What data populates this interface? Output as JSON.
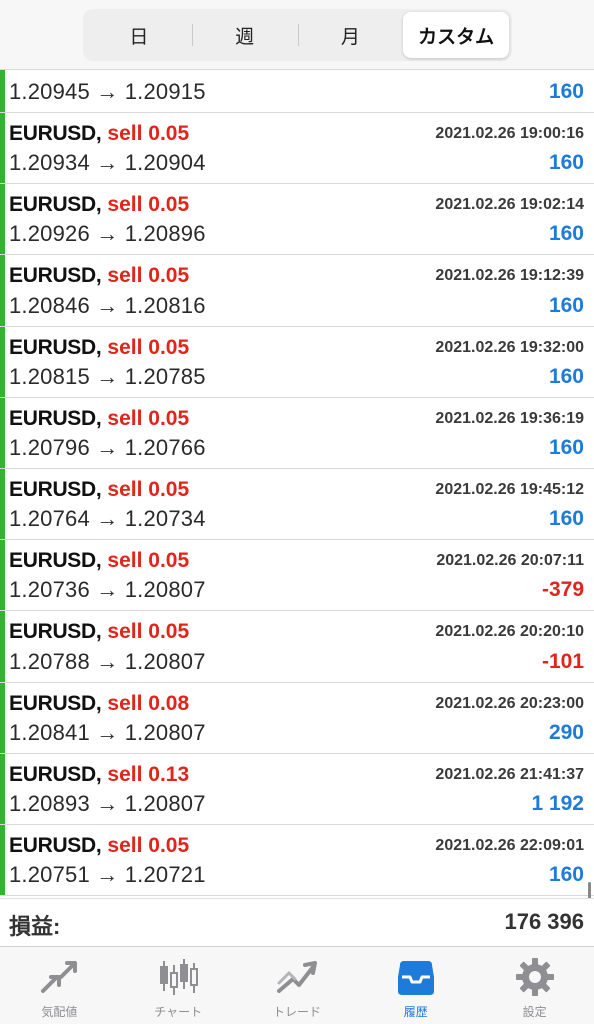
{
  "segments": [
    "日",
    "週",
    "月",
    "カスタム"
  ],
  "partial_row": {
    "prices": "1.20945 → 1.20915",
    "profit": "160"
  },
  "trades": [
    {
      "symbol": "EURUSD,",
      "side": "sell 0.05",
      "time": "2021.02.26 19:00:16",
      "prices": "1.20934 → 1.20904",
      "profit": "160",
      "sign": "pos"
    },
    {
      "symbol": "EURUSD,",
      "side": "sell 0.05",
      "time": "2021.02.26 19:02:14",
      "prices": "1.20926 → 1.20896",
      "profit": "160",
      "sign": "pos"
    },
    {
      "symbol": "EURUSD,",
      "side": "sell 0.05",
      "time": "2021.02.26 19:12:39",
      "prices": "1.20846 → 1.20816",
      "profit": "160",
      "sign": "pos"
    },
    {
      "symbol": "EURUSD,",
      "side": "sell 0.05",
      "time": "2021.02.26 19:32:00",
      "prices": "1.20815 → 1.20785",
      "profit": "160",
      "sign": "pos"
    },
    {
      "symbol": "EURUSD,",
      "side": "sell 0.05",
      "time": "2021.02.26 19:36:19",
      "prices": "1.20796 → 1.20766",
      "profit": "160",
      "sign": "pos"
    },
    {
      "symbol": "EURUSD,",
      "side": "sell 0.05",
      "time": "2021.02.26 19:45:12",
      "prices": "1.20764 → 1.20734",
      "profit": "160",
      "sign": "pos"
    },
    {
      "symbol": "EURUSD,",
      "side": "sell 0.05",
      "time": "2021.02.26 20:07:11",
      "prices": "1.20736 → 1.20807",
      "profit": "-379",
      "sign": "neg"
    },
    {
      "symbol": "EURUSD,",
      "side": "sell 0.05",
      "time": "2021.02.26 20:20:10",
      "prices": "1.20788 → 1.20807",
      "profit": "-101",
      "sign": "neg"
    },
    {
      "symbol": "EURUSD,",
      "side": "sell 0.08",
      "time": "2021.02.26 20:23:00",
      "prices": "1.20841 → 1.20807",
      "profit": "290",
      "sign": "pos"
    },
    {
      "symbol": "EURUSD,",
      "side": "sell 0.13",
      "time": "2021.02.26 21:41:37",
      "prices": "1.20893 → 1.20807",
      "profit": "1 192",
      "sign": "pos"
    },
    {
      "symbol": "EURUSD,",
      "side": "sell 0.05",
      "time": "2021.02.26 22:09:01",
      "prices": "1.20751 → 1.20721",
      "profit": "160",
      "sign": "pos"
    }
  ],
  "summary": {
    "label": "損益:",
    "value": "176 396"
  },
  "tabs": [
    {
      "label": "気配値",
      "icon": "quotes-icon"
    },
    {
      "label": "チャート",
      "icon": "chart-icon"
    },
    {
      "label": "トレード",
      "icon": "trade-icon"
    },
    {
      "label": "履歴",
      "icon": "history-icon",
      "active": true
    },
    {
      "label": "設定",
      "icon": "settings-icon"
    }
  ],
  "colors": {
    "accent": "#1e7bd9",
    "negative": "#e0251b",
    "profit_bar": "#34b233"
  }
}
